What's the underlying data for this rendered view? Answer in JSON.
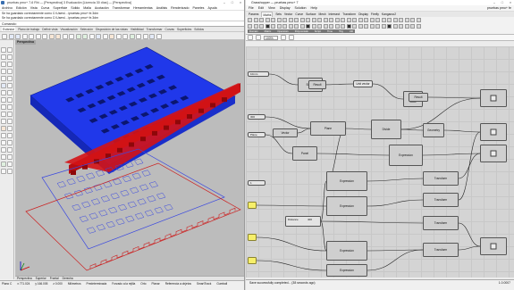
{
  "rhino": {
    "title": "pruebas pmo+ 7-6 Rhi — [Perspectiva] 3 Evaluación [Licencia 30 días] — [Perspectiva]",
    "menu": [
      "Archivo",
      "Edición",
      "Vista",
      "Curva",
      "Superficie",
      "Sólido",
      "Malla",
      "Acotación",
      "Transformar",
      "Herramientas",
      "Análisis",
      "Renderizado",
      "Paneles",
      "Ayuda"
    ],
    "command_history": [
      "Se ha guardado correctamente como C:\\Users\\...\\pruebas pmo+ fe.3dm",
      "Se ha guardado correctamente como C:\\Users\\...\\pruebas pmo+ fe.3dm"
    ],
    "command_prompt": "Comando:",
    "toolbar_tabs": [
      "Estándar",
      "Plano de trabajo",
      "Definir vista",
      "Visualización",
      "Selección",
      "Disposición de las vistas",
      "Visibilidad",
      "Transformar",
      "Curvas",
      "Superficies",
      "Sólidos"
    ],
    "viewport_label": "Perspectiva",
    "viewport_tabs": [
      "Perspectiva",
      "Superior",
      "Frontal",
      "Derecha"
    ],
    "status": [
      "Plano C",
      "x 771.024",
      "y 166.005",
      "z 0.000",
      "Milímetros",
      "Predeterminada",
      "Forzado a la rejilla",
      "Orto",
      "Planar",
      "Referencia a objetos",
      "SmartTrack",
      "Gumball",
      "Grabar historial",
      "Filtro"
    ]
  },
  "grasshopper": {
    "title": "Grasshopper — pruebas pmo+ 7",
    "doc_name": "pruebas pmo+ fe",
    "menu": [
      "File",
      "Edit",
      "View",
      "Display",
      "Solution",
      "Help"
    ],
    "tabs": [
      "Params",
      "Maths",
      "Sets",
      "Vector",
      "Curve",
      "Surface",
      "Mesh",
      "Intersect",
      "Transform",
      "Display",
      "Firefly",
      "Kangaroo2"
    ],
    "categories": [
      "Domain",
      "Matrix",
      "Operators",
      "Polynomials",
      "Script",
      "Time",
      "Trig",
      "Util"
    ],
    "zoom": "100%",
    "status": "Save successfully completed... (38 seconds ago)",
    "version": "1.0.0007",
    "nodes": {
      "series": "Series",
      "result": "Result",
      "expression": "Expression",
      "geometry": "Geometry",
      "transform": "Transform",
      "divide": "Divide",
      "vector": "Vector",
      "panel": "Panel",
      "plane": "Plane",
      "unit_vector": "Unit vector",
      "slider_label": "Distance",
      "slider_value": "400",
      "text_input": "10mm",
      "curve": "Curve",
      "points": "Points",
      "tangents": "Tangents",
      "params": "Parameters"
    }
  },
  "colors": {
    "solid_blue": "#1f36e8",
    "solid_red": "#c40f12",
    "wire_blue": "#3a48e0",
    "wire_red": "#cc2020",
    "node_yellow": "#f6ef6a"
  }
}
